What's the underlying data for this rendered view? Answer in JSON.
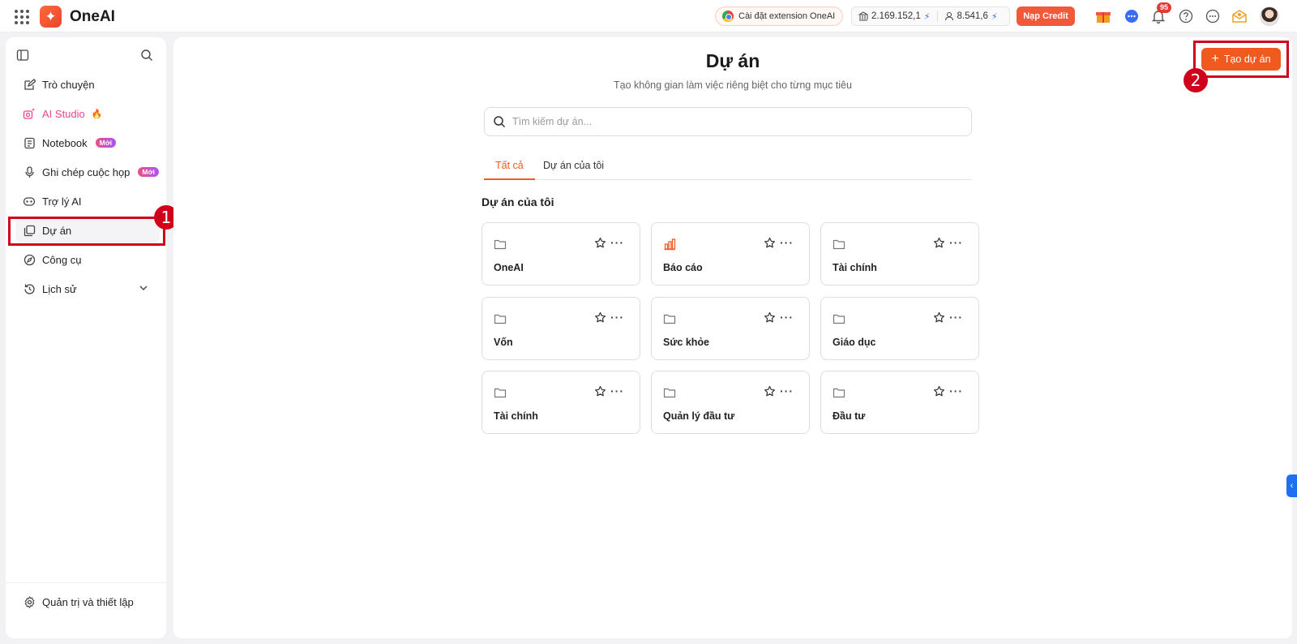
{
  "app": {
    "name": "OneAI"
  },
  "topbar": {
    "extension_label": "Cài đặt extension OneAI",
    "credits_value": "2.169.152,1",
    "personal_value": "8.541,6",
    "topup_label": "Nạp Credit",
    "notification_count": "95"
  },
  "sidebar": {
    "items": [
      {
        "label": "Trò chuyện"
      },
      {
        "label": "AI Studio"
      },
      {
        "label": "Notebook",
        "badge": "Mới"
      },
      {
        "label": "Ghi chép cuộc họp",
        "badge": "Mới"
      },
      {
        "label": "Trợ lý AI"
      },
      {
        "label": "Dự án"
      },
      {
        "label": "Công cụ"
      },
      {
        "label": "Lịch sử"
      }
    ],
    "footer_label": "Quản trị và thiết lập"
  },
  "main": {
    "title": "Dự án",
    "subtitle": "Tạo không gian làm việc riêng biệt cho từng mục tiêu",
    "search_placeholder": "Tìm kiếm dự án...",
    "tabs": [
      {
        "label": "Tất cả"
      },
      {
        "label": "Dự án của tôi"
      }
    ],
    "section_title": "Dự án của tôi",
    "create_label": "Tạo dự án",
    "projects": [
      {
        "name": "OneAI",
        "icon": "folder-icon"
      },
      {
        "name": "Báo cáo",
        "icon": "chart-icon"
      },
      {
        "name": "Tài chính",
        "icon": "folder-icon"
      },
      {
        "name": "Vốn",
        "icon": "folder-icon"
      },
      {
        "name": "Sức khỏe",
        "icon": "folder-icon"
      },
      {
        "name": "Giáo dục",
        "icon": "folder-icon"
      },
      {
        "name": "Tài chính",
        "icon": "folder-icon"
      },
      {
        "name": "Quản lý đầu tư",
        "icon": "folder-icon"
      },
      {
        "name": "Đầu tư",
        "icon": "folder-icon"
      }
    ]
  },
  "annotations": [
    {
      "label": "1"
    },
    {
      "label": "2"
    }
  ],
  "colors": {
    "accent": "#f05a1f",
    "annotation": "#d0021b",
    "studio": "#e8458b"
  }
}
